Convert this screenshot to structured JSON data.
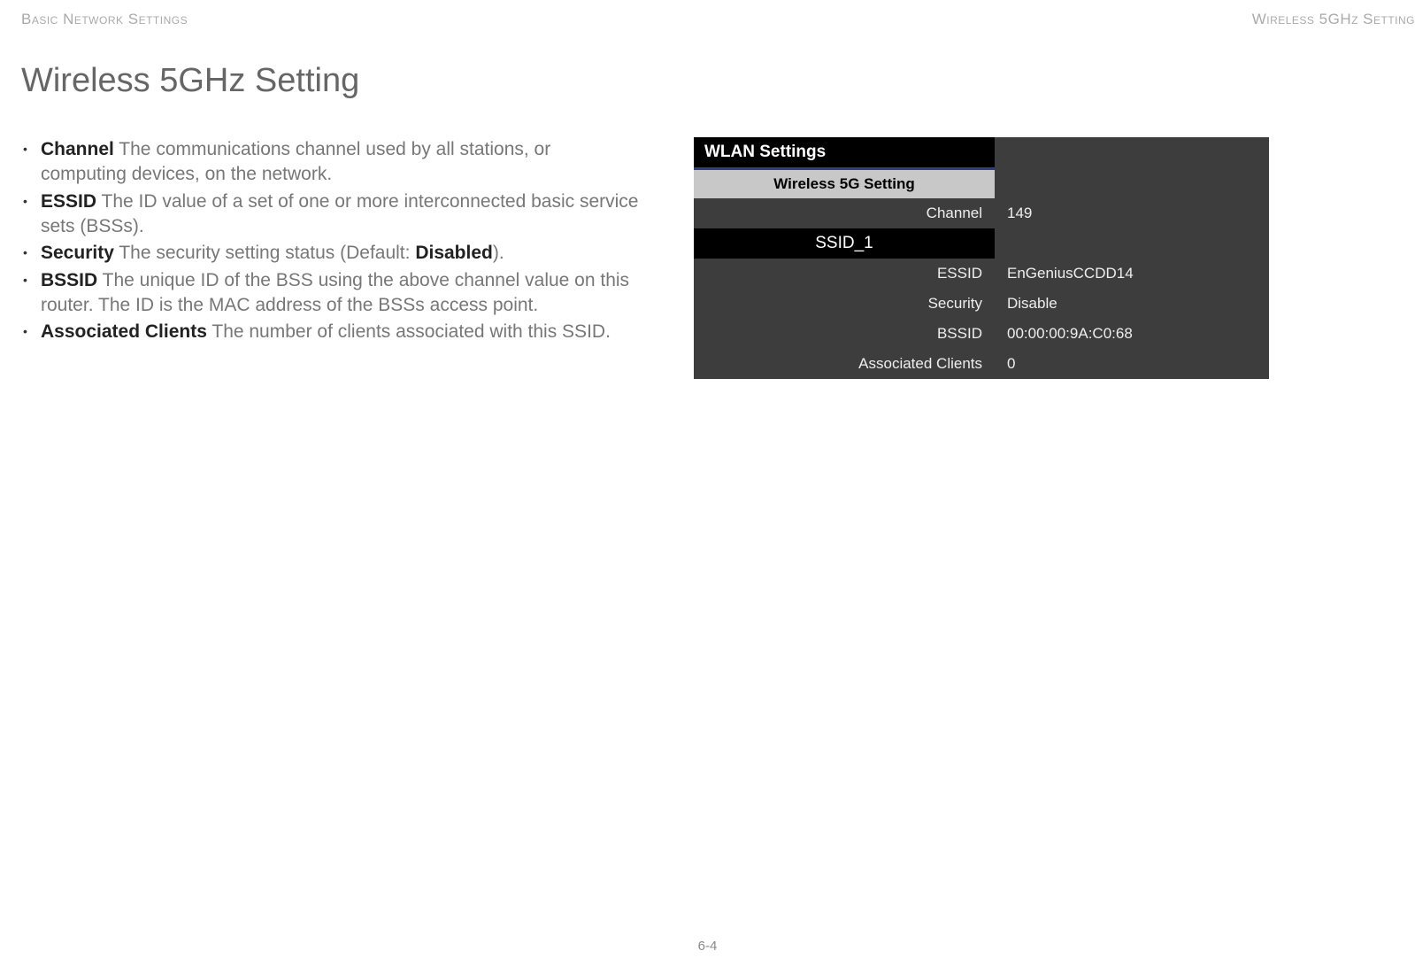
{
  "header": {
    "left": "Basic Network Settings",
    "right": "Wireless 5GHz Setting"
  },
  "title": "Wireless 5GHz Setting",
  "defs": {
    "channel_term": "Channel",
    "channel_desc": "  The communications channel used by all stations, or computing devices, on the network.",
    "essid_term": "ESSID",
    "essid_desc": "  The ID value of a set of one or more interconnected basic service sets (BSSs).",
    "security_term": "Security",
    "security_desc_pre": "  The security setting status (Default: ",
    "security_default": "Disabled",
    "security_desc_post": ").",
    "bssid_term": "BSSID",
    "bssid_desc": "  The unique ID of the BSS using the above channel value on this router. The ID is the MAC address of the BSSs access point.",
    "assoc_term": "Associated Clients",
    "assoc_desc": "  The number of clients associated with this SSID."
  },
  "panel": {
    "title": "WLAN Settings",
    "section": "Wireless 5G Setting",
    "ssid_header": "SSID_1",
    "rows": {
      "channel_label": "Channel",
      "channel_value": "149",
      "essid_label": "ESSID",
      "essid_value": "EnGeniusCCDD14",
      "security_label": "Security",
      "security_value": "Disable",
      "bssid_label": "BSSID",
      "bssid_value": "00:00:00:9A:C0:68",
      "assoc_label": "Associated Clients",
      "assoc_value": "0"
    }
  },
  "page_number": "6-4"
}
